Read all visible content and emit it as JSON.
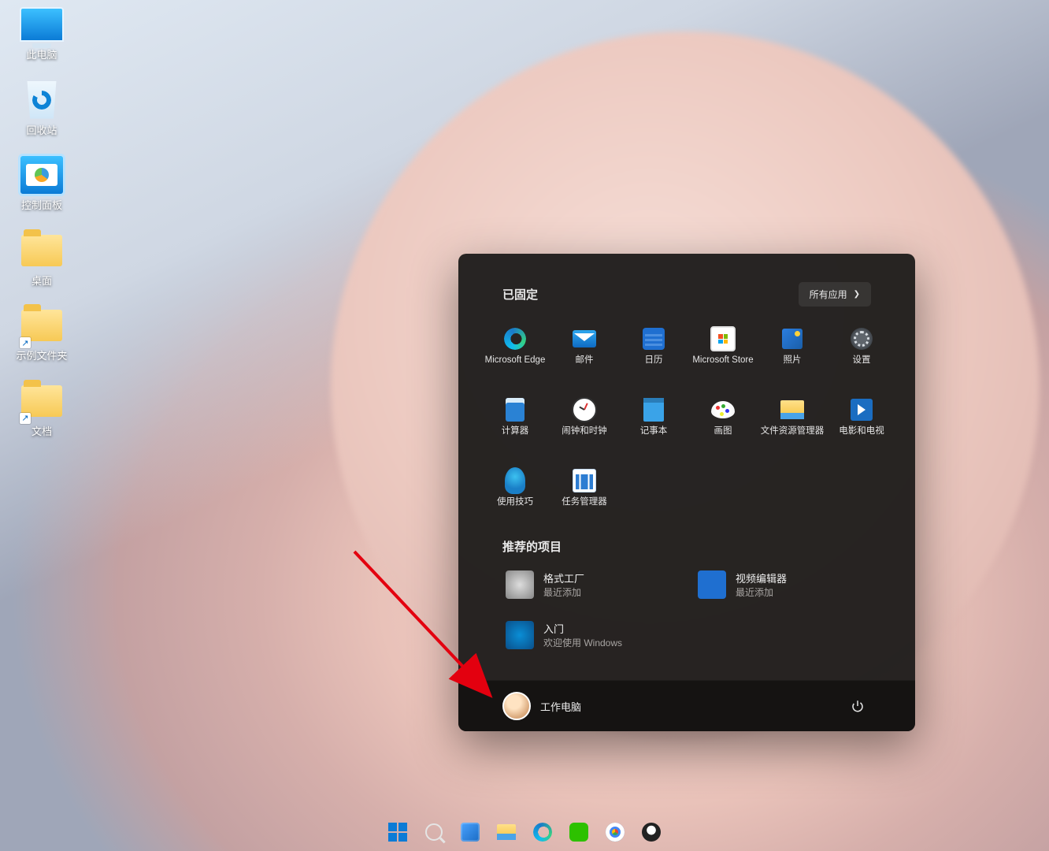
{
  "desktop_icons": [
    {
      "name": "this-pc",
      "label": "此电脑",
      "icon": "pc",
      "shortcut": false
    },
    {
      "name": "recycle-bin",
      "label": "回收站",
      "icon": "bin",
      "shortcut": false
    },
    {
      "name": "control-panel",
      "label": "控制面板",
      "icon": "cp",
      "shortcut": false
    },
    {
      "name": "desktop-folder",
      "label": "桌面",
      "icon": "folder",
      "shortcut": false
    },
    {
      "name": "sample-folder",
      "label": "示例文件夹",
      "icon": "folder",
      "shortcut": true
    },
    {
      "name": "documents-folder",
      "label": "文档",
      "icon": "folder",
      "shortcut": true
    }
  ],
  "start_menu": {
    "pinned_header": "已固定",
    "all_apps_label": "所有应用",
    "pinned": [
      {
        "name": "edge",
        "label": "Microsoft Edge",
        "icon": "edge"
      },
      {
        "name": "mail",
        "label": "邮件",
        "icon": "mail"
      },
      {
        "name": "calendar",
        "label": "日历",
        "icon": "cal"
      },
      {
        "name": "store",
        "label": "Microsoft Store",
        "icon": "store"
      },
      {
        "name": "photos",
        "label": "照片",
        "icon": "photos"
      },
      {
        "name": "settings",
        "label": "设置",
        "icon": "settings"
      },
      {
        "name": "calculator",
        "label": "计算器",
        "icon": "calc"
      },
      {
        "name": "alarms",
        "label": "闹钟和时钟",
        "icon": "clock"
      },
      {
        "name": "notepad",
        "label": "记事本",
        "icon": "note"
      },
      {
        "name": "paint",
        "label": "画图",
        "icon": "paint"
      },
      {
        "name": "explorer",
        "label": "文件资源管理器",
        "icon": "explorer"
      },
      {
        "name": "movies",
        "label": "电影和电视",
        "icon": "movies"
      },
      {
        "name": "tips",
        "label": "使用技巧",
        "icon": "tips"
      },
      {
        "name": "taskmgr",
        "label": "任务管理器",
        "icon": "task"
      }
    ],
    "recommended_header": "推荐的项目",
    "recommended": [
      {
        "name": "format-factory",
        "title": "格式工厂",
        "subtitle": "最近添加",
        "icon": "ff"
      },
      {
        "name": "video-editor",
        "title": "视频编辑器",
        "subtitle": "最近添加",
        "icon": "vid"
      },
      {
        "name": "get-started",
        "title": "入门",
        "subtitle": "欢迎使用 Windows",
        "icon": "start"
      }
    ],
    "user": {
      "name": "工作电脑"
    }
  },
  "taskbar": [
    {
      "name": "start",
      "icon": "winlogo",
      "running": false
    },
    {
      "name": "search",
      "icon": "search",
      "running": false
    },
    {
      "name": "taskview",
      "icon": "taskview",
      "running": false
    },
    {
      "name": "explorer",
      "icon": "explorer",
      "running": false
    },
    {
      "name": "edge",
      "icon": "edge",
      "running": false
    },
    {
      "name": "wechat",
      "icon": "wechat",
      "running": false
    },
    {
      "name": "chrome",
      "icon": "chrome",
      "running": false
    },
    {
      "name": "tencent",
      "icon": "tencent",
      "running": false
    }
  ]
}
